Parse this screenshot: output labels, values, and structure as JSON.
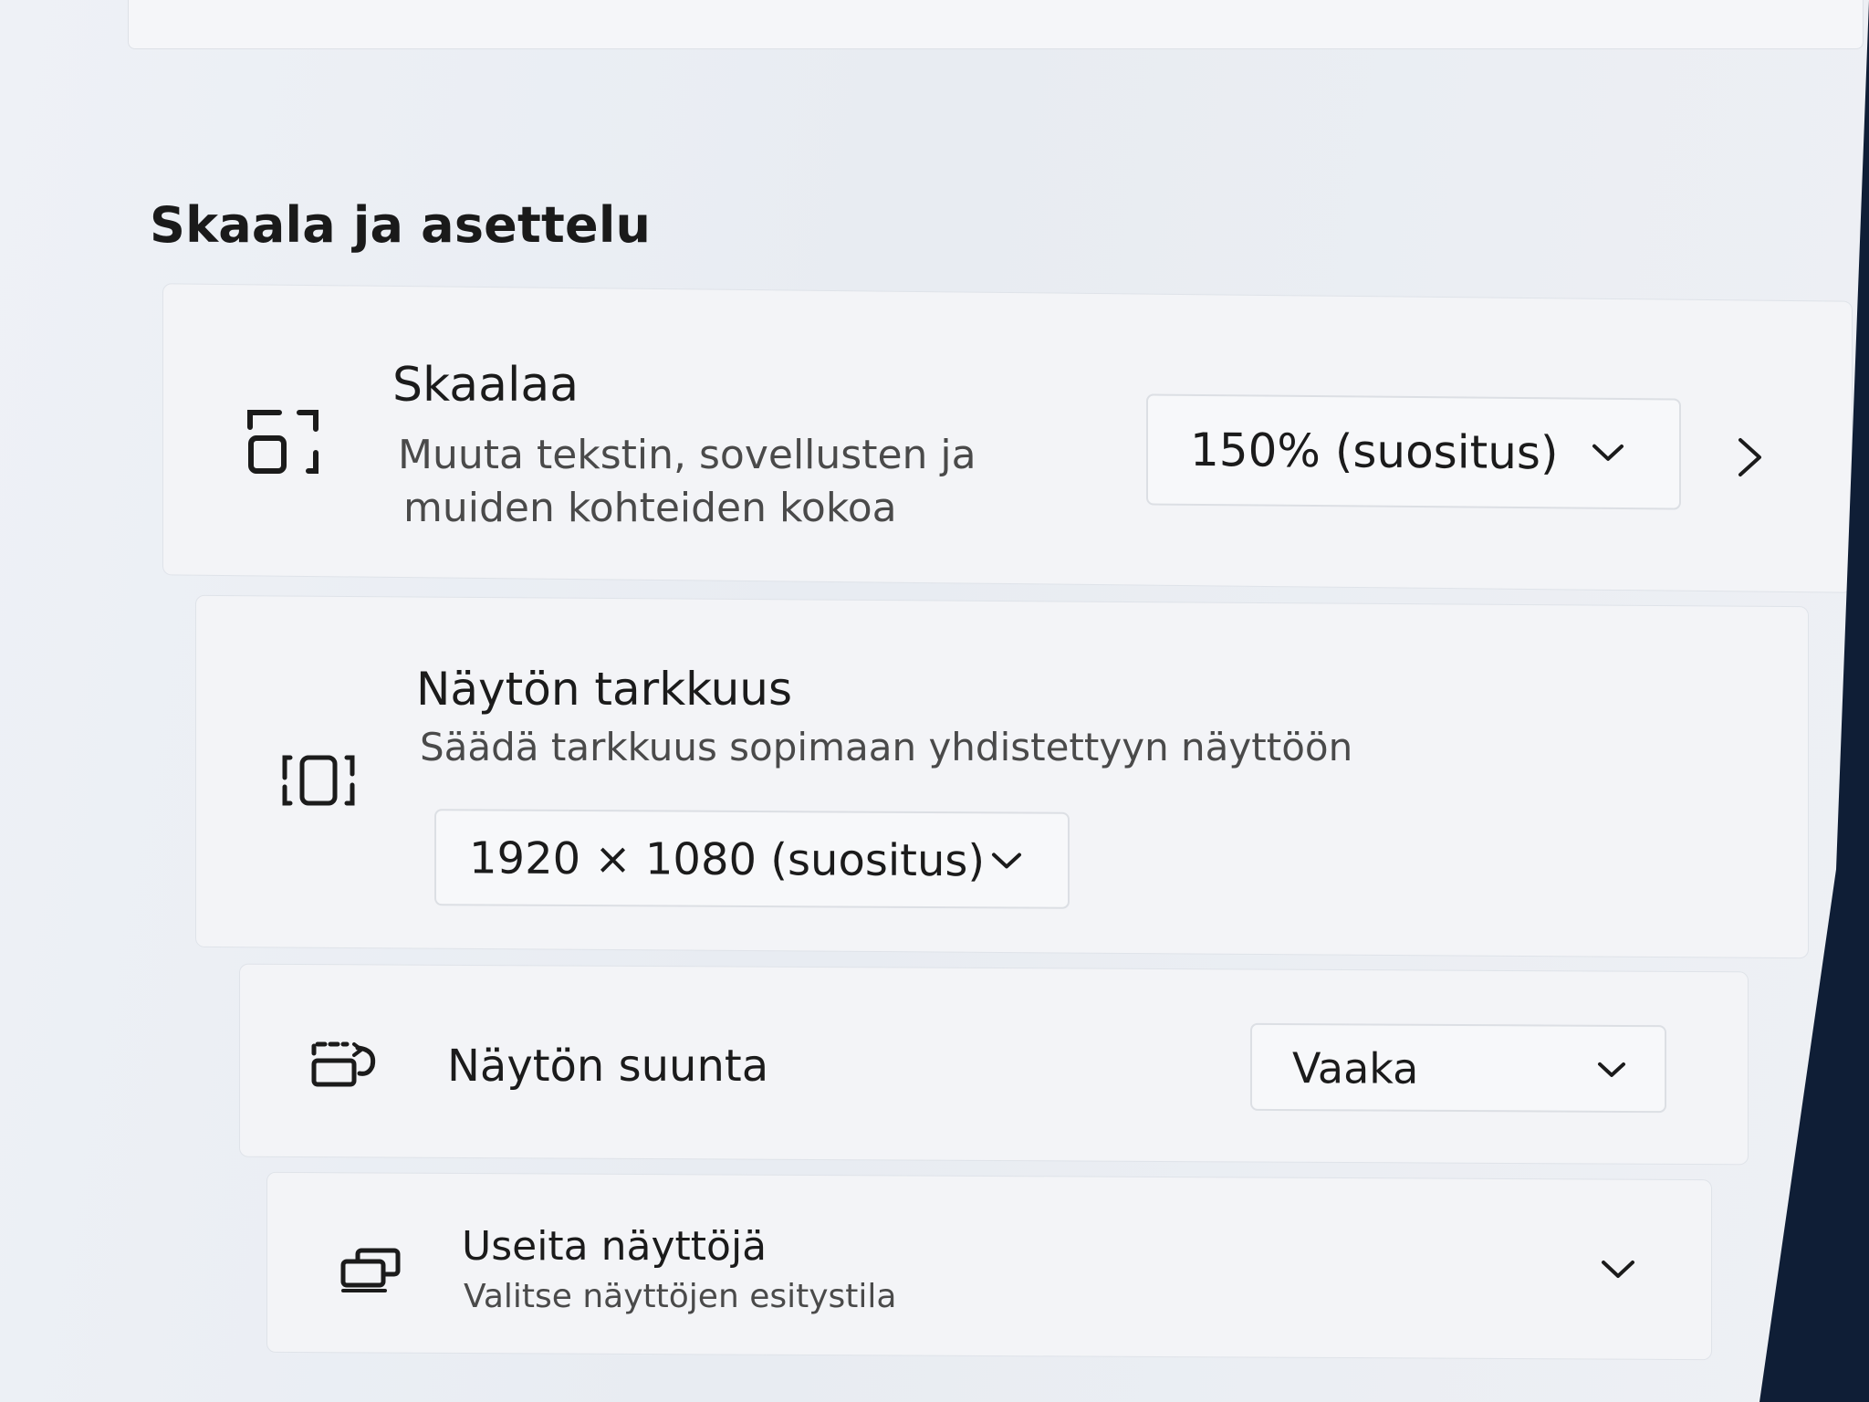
{
  "section": {
    "title": "Skaala ja asettelu"
  },
  "scale": {
    "title": "Skaalaa",
    "description_line1": "Muuta tekstin, sovellusten ja",
    "description_line2": "muiden kohteiden kokoa",
    "selected": "150% (suositus)",
    "icon": "scale-icon"
  },
  "resolution": {
    "title": "Näytön tarkkuus",
    "description": "Säädä tarkkuus sopimaan yhdistettyyn näyttöön",
    "selected": "1920 × 1080 (suositus)",
    "icon": "resolution-icon"
  },
  "orientation": {
    "title": "Näytön suunta",
    "selected": "Vaaka",
    "icon": "orientation-icon"
  },
  "multiple_displays": {
    "title": "Useita näyttöjä",
    "description": "Valitse näyttöjen esitystila",
    "icon": "multiple-displays-icon"
  },
  "colors": {
    "background": "#e9edf3",
    "card": "#f3f4f7",
    "text": "#1b1b1b",
    "secondary_text": "#4a4a4a",
    "bezel": "#0f1e36"
  }
}
